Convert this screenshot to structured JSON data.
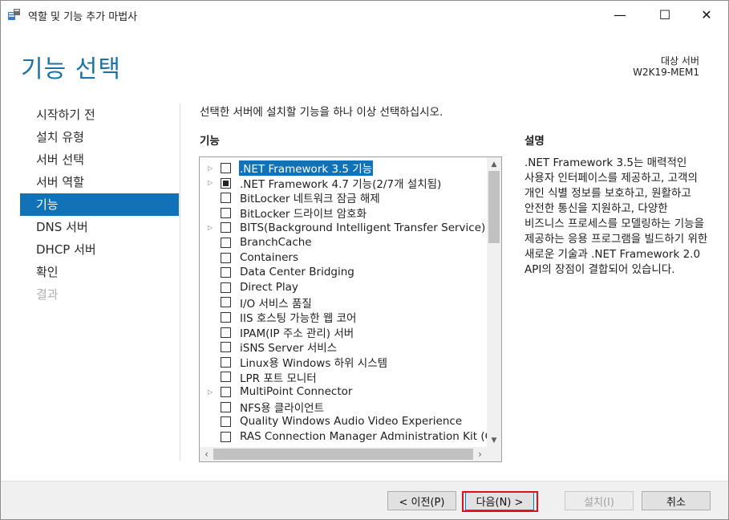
{
  "window": {
    "title": "역할 및 기능 추가 마법사",
    "controls": {
      "minimize": "—",
      "maximize": "☐",
      "close": "✕"
    }
  },
  "header": {
    "page_title": "기능 선택",
    "destination_label": "대상 서버",
    "destination_value": "W2K19-MEM1"
  },
  "nav": {
    "items": [
      {
        "label": "시작하기 전",
        "state": "normal"
      },
      {
        "label": "설치 유형",
        "state": "normal"
      },
      {
        "label": "서버 선택",
        "state": "normal"
      },
      {
        "label": "서버 역할",
        "state": "normal"
      },
      {
        "label": "기능",
        "state": "active"
      },
      {
        "label": "DNS 서버",
        "state": "normal"
      },
      {
        "label": "DHCP 서버",
        "state": "normal"
      },
      {
        "label": "확인",
        "state": "normal"
      },
      {
        "label": "결과",
        "state": "disabled"
      }
    ]
  },
  "main": {
    "instruction": "선택한 서버에 설치할 기능을 하나 이상 선택하십시오.",
    "features_header": "기능",
    "description_header": "설명",
    "description_text": ".NET Framework 3.5는 매력적인 사용자 인터페이스를 제공하고, 고객의 개인 식별 정보를 보호하고, 원활하고 안전한 통신을 지원하고, 다양한 비즈니스 프로세스를 모델링하는 기능을 제공하는 응용 프로그램을 빌드하기 위한 새로운 기술과 .NET Framework 2.0 API의 장점이 결합되어 있습니다.",
    "features": [
      {
        "label": ".NET Framework 3.5 기능",
        "expandable": true,
        "check": "none",
        "selected": true
      },
      {
        "label": ".NET Framework 4.7 기능(2/7개 설치됨)",
        "expandable": true,
        "check": "partial",
        "selected": false
      },
      {
        "label": "BitLocker 네트워크 잠금 해제",
        "expandable": false,
        "check": "none",
        "selected": false
      },
      {
        "label": "BitLocker 드라이브 암호화",
        "expandable": false,
        "check": "none",
        "selected": false
      },
      {
        "label": "BITS(Background Intelligent Transfer Service)",
        "expandable": true,
        "check": "none",
        "selected": false
      },
      {
        "label": "BranchCache",
        "expandable": false,
        "check": "none",
        "selected": false
      },
      {
        "label": "Containers",
        "expandable": false,
        "check": "none",
        "selected": false
      },
      {
        "label": "Data Center Bridging",
        "expandable": false,
        "check": "none",
        "selected": false
      },
      {
        "label": "Direct Play",
        "expandable": false,
        "check": "none",
        "selected": false
      },
      {
        "label": "I/O 서비스 품질",
        "expandable": false,
        "check": "none",
        "selected": false
      },
      {
        "label": "IIS 호스팅 가능한 웹 코어",
        "expandable": false,
        "check": "none",
        "selected": false
      },
      {
        "label": "IPAM(IP 주소 관리) 서버",
        "expandable": false,
        "check": "none",
        "selected": false
      },
      {
        "label": "iSNS Server 서비스",
        "expandable": false,
        "check": "none",
        "selected": false
      },
      {
        "label": "Linux용 Windows 하위 시스템",
        "expandable": false,
        "check": "none",
        "selected": false
      },
      {
        "label": "LPR 포트 모니터",
        "expandable": false,
        "check": "none",
        "selected": false
      },
      {
        "label": "MultiPoint Connector",
        "expandable": true,
        "check": "none",
        "selected": false
      },
      {
        "label": "NFS용 클라이언트",
        "expandable": false,
        "check": "none",
        "selected": false
      },
      {
        "label": "Quality Windows Audio Video Experience",
        "expandable": false,
        "check": "none",
        "selected": false
      },
      {
        "label": "RAS Connection Manager Administration Kit (CM",
        "expandable": false,
        "check": "none",
        "selected": false
      }
    ]
  },
  "footer": {
    "prev_label": "< 이전(P)",
    "next_label": "다음(N) >",
    "install_label": "설치(I)",
    "cancel_label": "취소"
  },
  "colors": {
    "accent": "#1272b8",
    "title": "#1c73a8",
    "highlight": "#e0101a"
  }
}
